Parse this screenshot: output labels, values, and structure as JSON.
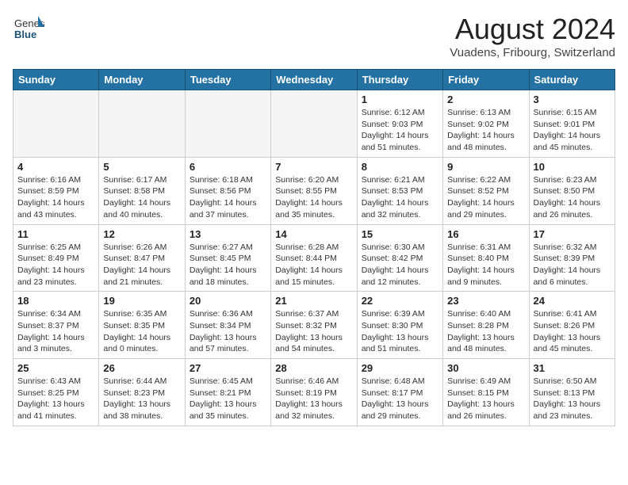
{
  "header": {
    "logo_general": "General",
    "logo_blue": "Blue",
    "month_year": "August 2024",
    "location": "Vuadens, Fribourg, Switzerland"
  },
  "weekdays": [
    "Sunday",
    "Monday",
    "Tuesday",
    "Wednesday",
    "Thursday",
    "Friday",
    "Saturday"
  ],
  "weeks": [
    [
      {
        "day": "",
        "content": ""
      },
      {
        "day": "",
        "content": ""
      },
      {
        "day": "",
        "content": ""
      },
      {
        "day": "",
        "content": ""
      },
      {
        "day": "1",
        "content": "Sunrise: 6:12 AM\nSunset: 9:03 PM\nDaylight: 14 hours\nand 51 minutes."
      },
      {
        "day": "2",
        "content": "Sunrise: 6:13 AM\nSunset: 9:02 PM\nDaylight: 14 hours\nand 48 minutes."
      },
      {
        "day": "3",
        "content": "Sunrise: 6:15 AM\nSunset: 9:01 PM\nDaylight: 14 hours\nand 45 minutes."
      }
    ],
    [
      {
        "day": "4",
        "content": "Sunrise: 6:16 AM\nSunset: 8:59 PM\nDaylight: 14 hours\nand 43 minutes."
      },
      {
        "day": "5",
        "content": "Sunrise: 6:17 AM\nSunset: 8:58 PM\nDaylight: 14 hours\nand 40 minutes."
      },
      {
        "day": "6",
        "content": "Sunrise: 6:18 AM\nSunset: 8:56 PM\nDaylight: 14 hours\nand 37 minutes."
      },
      {
        "day": "7",
        "content": "Sunrise: 6:20 AM\nSunset: 8:55 PM\nDaylight: 14 hours\nand 35 minutes."
      },
      {
        "day": "8",
        "content": "Sunrise: 6:21 AM\nSunset: 8:53 PM\nDaylight: 14 hours\nand 32 minutes."
      },
      {
        "day": "9",
        "content": "Sunrise: 6:22 AM\nSunset: 8:52 PM\nDaylight: 14 hours\nand 29 minutes."
      },
      {
        "day": "10",
        "content": "Sunrise: 6:23 AM\nSunset: 8:50 PM\nDaylight: 14 hours\nand 26 minutes."
      }
    ],
    [
      {
        "day": "11",
        "content": "Sunrise: 6:25 AM\nSunset: 8:49 PM\nDaylight: 14 hours\nand 23 minutes."
      },
      {
        "day": "12",
        "content": "Sunrise: 6:26 AM\nSunset: 8:47 PM\nDaylight: 14 hours\nand 21 minutes."
      },
      {
        "day": "13",
        "content": "Sunrise: 6:27 AM\nSunset: 8:45 PM\nDaylight: 14 hours\nand 18 minutes."
      },
      {
        "day": "14",
        "content": "Sunrise: 6:28 AM\nSunset: 8:44 PM\nDaylight: 14 hours\nand 15 minutes."
      },
      {
        "day": "15",
        "content": "Sunrise: 6:30 AM\nSunset: 8:42 PM\nDaylight: 14 hours\nand 12 minutes."
      },
      {
        "day": "16",
        "content": "Sunrise: 6:31 AM\nSunset: 8:40 PM\nDaylight: 14 hours\nand 9 minutes."
      },
      {
        "day": "17",
        "content": "Sunrise: 6:32 AM\nSunset: 8:39 PM\nDaylight: 14 hours\nand 6 minutes."
      }
    ],
    [
      {
        "day": "18",
        "content": "Sunrise: 6:34 AM\nSunset: 8:37 PM\nDaylight: 14 hours\nand 3 minutes."
      },
      {
        "day": "19",
        "content": "Sunrise: 6:35 AM\nSunset: 8:35 PM\nDaylight: 14 hours\nand 0 minutes."
      },
      {
        "day": "20",
        "content": "Sunrise: 6:36 AM\nSunset: 8:34 PM\nDaylight: 13 hours\nand 57 minutes."
      },
      {
        "day": "21",
        "content": "Sunrise: 6:37 AM\nSunset: 8:32 PM\nDaylight: 13 hours\nand 54 minutes."
      },
      {
        "day": "22",
        "content": "Sunrise: 6:39 AM\nSunset: 8:30 PM\nDaylight: 13 hours\nand 51 minutes."
      },
      {
        "day": "23",
        "content": "Sunrise: 6:40 AM\nSunset: 8:28 PM\nDaylight: 13 hours\nand 48 minutes."
      },
      {
        "day": "24",
        "content": "Sunrise: 6:41 AM\nSunset: 8:26 PM\nDaylight: 13 hours\nand 45 minutes."
      }
    ],
    [
      {
        "day": "25",
        "content": "Sunrise: 6:43 AM\nSunset: 8:25 PM\nDaylight: 13 hours\nand 41 minutes."
      },
      {
        "day": "26",
        "content": "Sunrise: 6:44 AM\nSunset: 8:23 PM\nDaylight: 13 hours\nand 38 minutes."
      },
      {
        "day": "27",
        "content": "Sunrise: 6:45 AM\nSunset: 8:21 PM\nDaylight: 13 hours\nand 35 minutes."
      },
      {
        "day": "28",
        "content": "Sunrise: 6:46 AM\nSunset: 8:19 PM\nDaylight: 13 hours\nand 32 minutes."
      },
      {
        "day": "29",
        "content": "Sunrise: 6:48 AM\nSunset: 8:17 PM\nDaylight: 13 hours\nand 29 minutes."
      },
      {
        "day": "30",
        "content": "Sunrise: 6:49 AM\nSunset: 8:15 PM\nDaylight: 13 hours\nand 26 minutes."
      },
      {
        "day": "31",
        "content": "Sunrise: 6:50 AM\nSunset: 8:13 PM\nDaylight: 13 hours\nand 23 minutes."
      }
    ]
  ]
}
